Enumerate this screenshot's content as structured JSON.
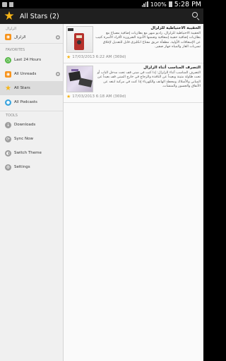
{
  "statusbar": {
    "battery": "100%",
    "time": "5:28 PM"
  },
  "appbar": {
    "title": "All Stars (2)"
  },
  "sidebar": {
    "top_section": "الزلزال",
    "feed": {
      "label": "الزلزال",
      "badge": ""
    },
    "favorites_header": "FAVORITES",
    "favorites": [
      {
        "label": "Last 24 Hours",
        "icon": "clock-icon",
        "badge": ""
      },
      {
        "label": "All Unreads",
        "icon": "rss-icon",
        "badge": ""
      },
      {
        "label": "All Stars",
        "icon": "star-icon",
        "badge": ""
      },
      {
        "label": "All Podcasts",
        "icon": "podcast-icon",
        "badge": ""
      }
    ],
    "tools_header": "TOOLS",
    "tools": [
      {
        "label": "Downloads",
        "icon": "download-icon"
      },
      {
        "label": "Sync Now",
        "icon": "sync-icon"
      },
      {
        "label": "Switch Theme",
        "icon": "theme-icon"
      },
      {
        "label": "Settings",
        "icon": "gear-icon"
      }
    ]
  },
  "articles": [
    {
      "headline": "الحقيبة الاحتياطية للزلزال",
      "summary": "الحقيبة الاحتياطية للزلزال، راديو مبهر مع بطاريات إضافية مصباح مع بطاريات إضافية حقيبة إسعافية وضمنها الأدوية الضرورية لأفراد الأسرة كتيب عن الإسعافات الأولية. مطفأة حريق مفتاح انكليزي قابل للتعديل لإغلاق تسربات الغاز والمياه جهاز صفير.",
      "date": "17/03/2013 6:22 AM (369d)"
    },
    {
      "headline": "التصرف المناسب أثناء الزلزال",
      "summary": "التصرف المناسب أثناء الزلزال: إذا كنت في مبنى قف تحت مدخل الباب أو تحت طاولة متينة وبعيداً عن النافذة والزجاج في خارج المبنى قف بعيداً عن المباني والأسلاك ومحطة الهاتف والكهرباء إذا كنت في مركبة ابتعد عن الأنفاق والجسور والمنشآت.",
      "date": "17/03/2013 6:18 AM (369d)"
    }
  ],
  "colors": {
    "accent": "#f6b417",
    "appbar": "#1f1f1f",
    "sidebar": "#f0f0f0"
  }
}
